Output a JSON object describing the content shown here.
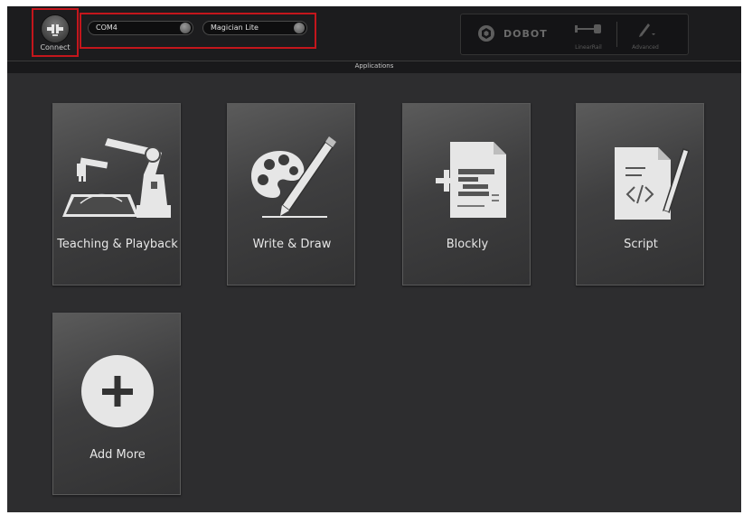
{
  "topbar": {
    "connect_label": "Connect",
    "port_value": "COM4",
    "model_value": "Magician Lite",
    "brand": "DOBOT",
    "tools": [
      {
        "label": "LinearRail",
        "icon": "linear-rail-icon"
      },
      {
        "label": "Advanced",
        "icon": "pen-tool-icon"
      }
    ]
  },
  "section_title": "Applications",
  "tiles": [
    {
      "label": "Teaching & Playback",
      "icon": "robot-arm-icon"
    },
    {
      "label": "Write & Draw",
      "icon": "palette-brush-icon"
    },
    {
      "label": "Blockly",
      "icon": "blockly-document-icon"
    },
    {
      "label": "Script",
      "icon": "code-document-icon"
    },
    {
      "label": "Add More",
      "icon": "add-circle-icon"
    }
  ],
  "colors": {
    "highlight_border": "#c4161c",
    "background": "#2d2d2f",
    "topbar": "#1c1c1e"
  }
}
